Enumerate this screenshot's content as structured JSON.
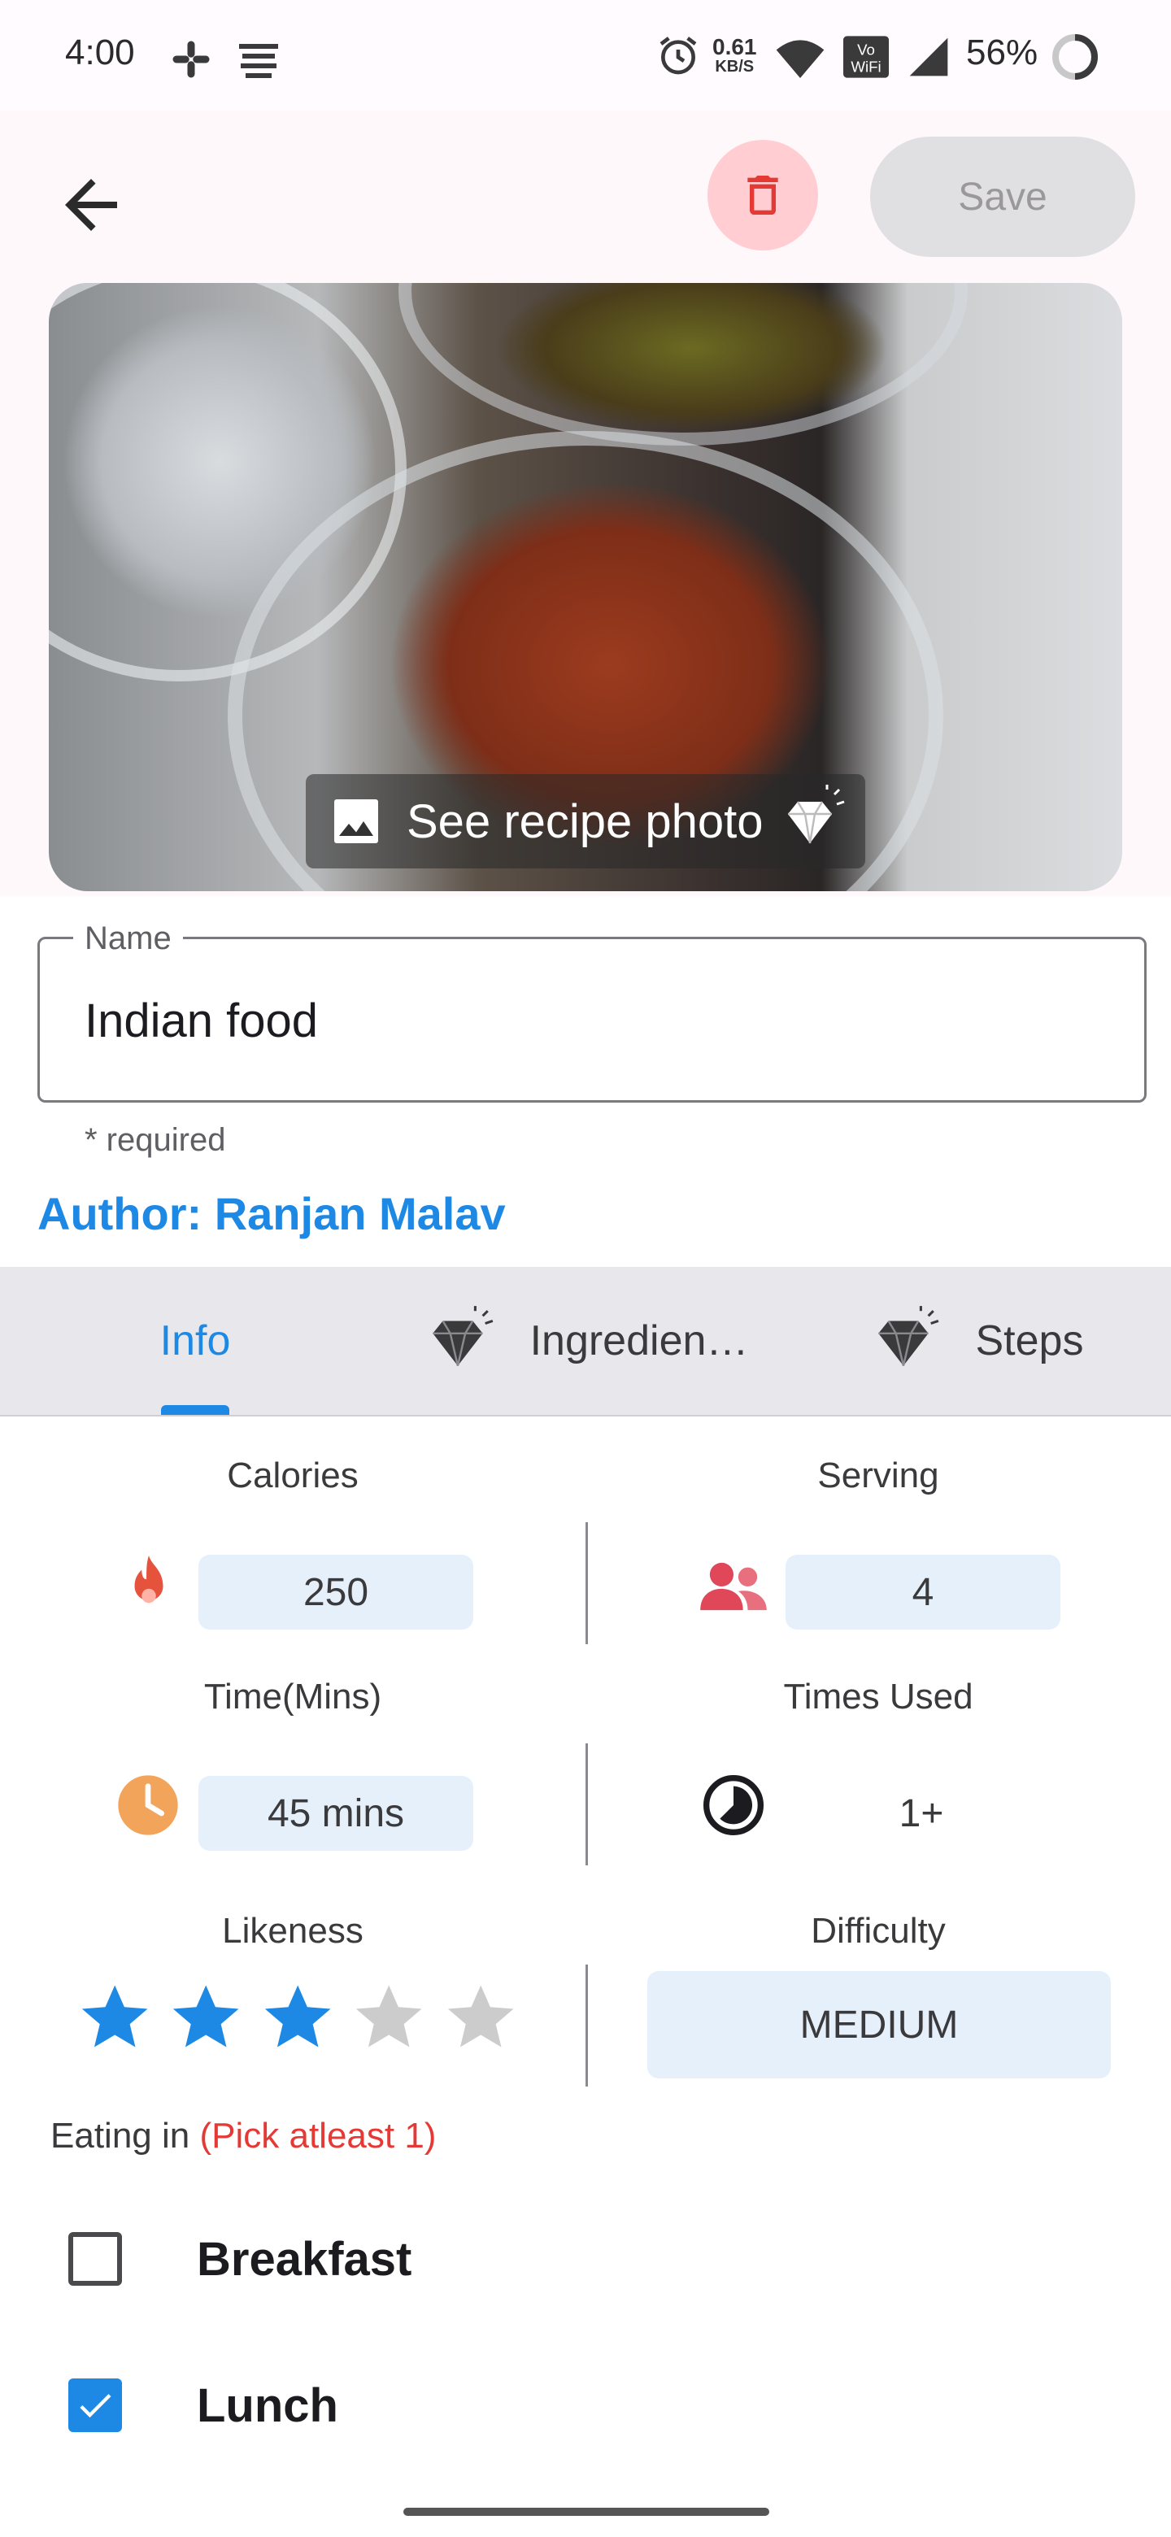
{
  "status_bar": {
    "time": "4:00",
    "net_speed_value": "0.61",
    "net_speed_unit": "KB/S",
    "battery_percent": "56%"
  },
  "header": {
    "back_icon": "arrow-back-icon",
    "delete_icon": "trash-icon",
    "save_label": "Save"
  },
  "photo": {
    "see_photo_label": "See recipe photo",
    "image_icon": "image-icon",
    "premium_icon": "diamond-icon"
  },
  "name_field": {
    "label": "Name",
    "value": "Indian food",
    "helper": "* required"
  },
  "author": "Author: Ranjan Malav",
  "tabs": [
    {
      "label": "Info",
      "active": true
    },
    {
      "label": "Ingredien…",
      "icon": "diamond-icon"
    },
    {
      "label": "Steps",
      "icon": "diamond-icon"
    }
  ],
  "info": {
    "calories": {
      "label": "Calories",
      "value": "250",
      "icon": "fire-icon"
    },
    "serving": {
      "label": "Serving",
      "value": "4",
      "icon": "people-icon"
    },
    "time": {
      "label": "Time(Mins)",
      "value": "45 mins",
      "icon": "clock-icon"
    },
    "times_used": {
      "label": "Times Used",
      "value": "1+",
      "icon": "progress-circle-icon"
    },
    "likeness": {
      "label": "Likeness",
      "rating": 3,
      "max": 5
    },
    "difficulty": {
      "label": "Difficulty",
      "value": "MEDIUM"
    }
  },
  "eating_in": {
    "label": "Eating in",
    "hint": "(Pick atleast 1)",
    "options": [
      {
        "label": "Breakfast",
        "checked": false
      },
      {
        "label": "Lunch",
        "checked": true
      }
    ]
  },
  "colors": {
    "accent": "#1e88e5",
    "delete_bg": "#ffcdd2",
    "delete_icon": "#e53935",
    "star_on": "#1e88e5",
    "star_off": "#cccccc"
  }
}
